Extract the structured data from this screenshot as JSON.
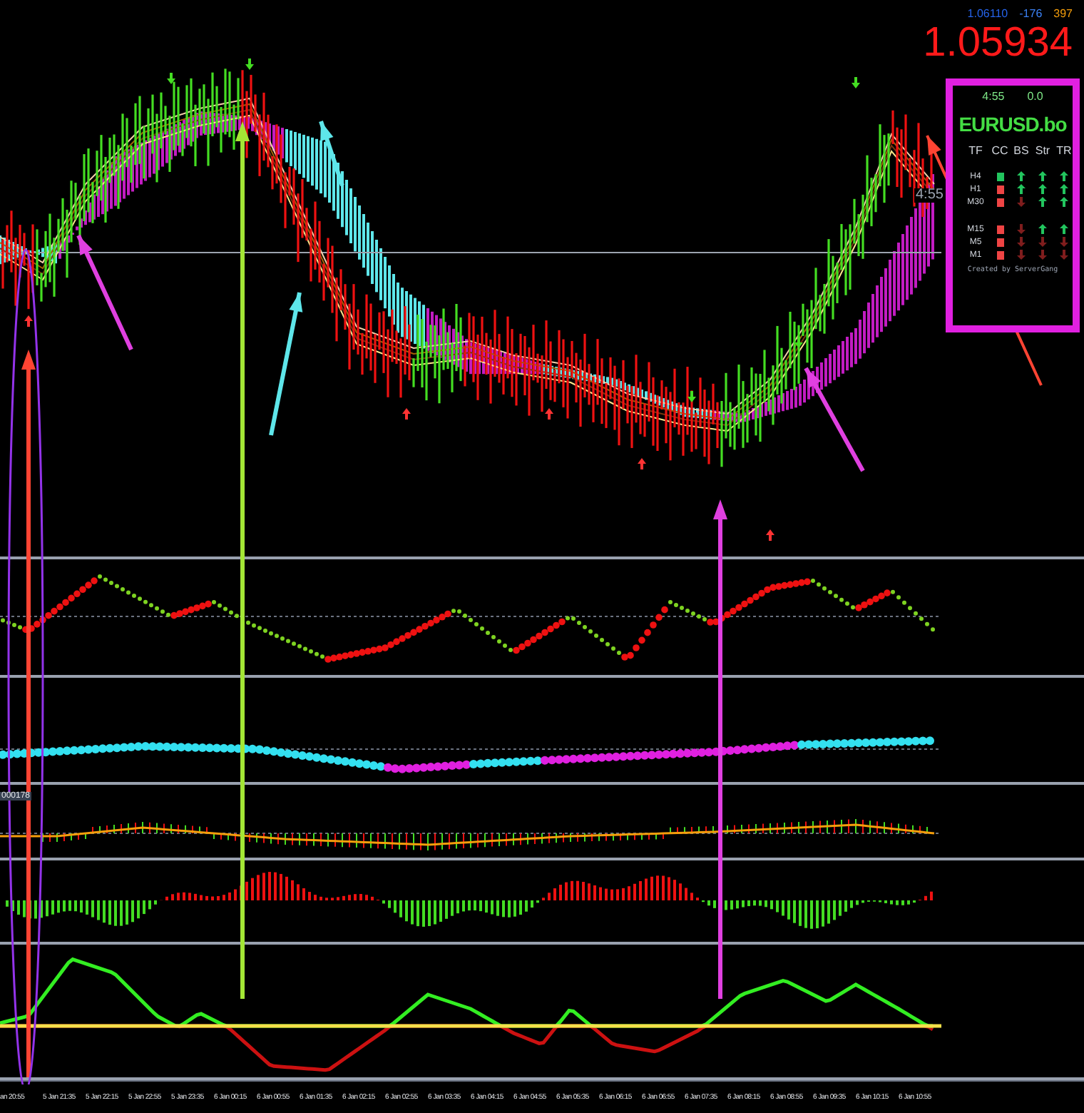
{
  "quote": {
    "bid": "1.06110",
    "change": "-176",
    "volume": "397",
    "price": "1.05934"
  },
  "side_timer": "4:55",
  "info_panel": {
    "timer": "4:55",
    "spread": "0.0",
    "symbol": "EURUSD.bo",
    "columns": [
      "TF",
      "CC",
      "BS",
      "Str",
      "TR"
    ],
    "rows": [
      {
        "tf": "H4",
        "color": "#22c55e",
        "bs_up": true,
        "str_up": true,
        "tr_up": true
      },
      {
        "tf": "H1",
        "color": "#ef4444",
        "bs_up": true,
        "str_up": true,
        "tr_up": true
      },
      {
        "tf": "M30",
        "color": "#ef4444",
        "bs_up": false,
        "str_up": true,
        "tr_up": true
      },
      {
        "tf": "M15",
        "color": "#ef4444",
        "bs_up": false,
        "str_up": true,
        "tr_up": true
      },
      {
        "tf": "M5",
        "color": "#ef4444",
        "bs_up": false,
        "str_up": false,
        "tr_up": false
      },
      {
        "tf": "M1",
        "color": "#ef4444",
        "bs_up": false,
        "str_up": false,
        "tr_up": false
      }
    ],
    "credit": "Created by ServerGang"
  },
  "panel_label": "000178",
  "time_axis": [
    "an 20:55",
    "5 Jan 21:35",
    "5 Jan 22:15",
    "5 Jan 22:55",
    "5 Jan 23:35",
    "6 Jan 00:15",
    "6 Jan 00:55",
    "6 Jan 01:35",
    "6 Jan 02:15",
    "6 Jan 02:55",
    "6 Jan 03:35",
    "6 Jan 04:15",
    "6 Jan 04:55",
    "6 Jan 05:35",
    "6 Jan 06:15",
    "6 Jan 06:55",
    "6 Jan 07:35",
    "6 Jan 08:15",
    "6 Jan 08:55",
    "6 Jan 09:35",
    "6 Jan 10:15",
    "6 Jan 10:55"
  ]
}
